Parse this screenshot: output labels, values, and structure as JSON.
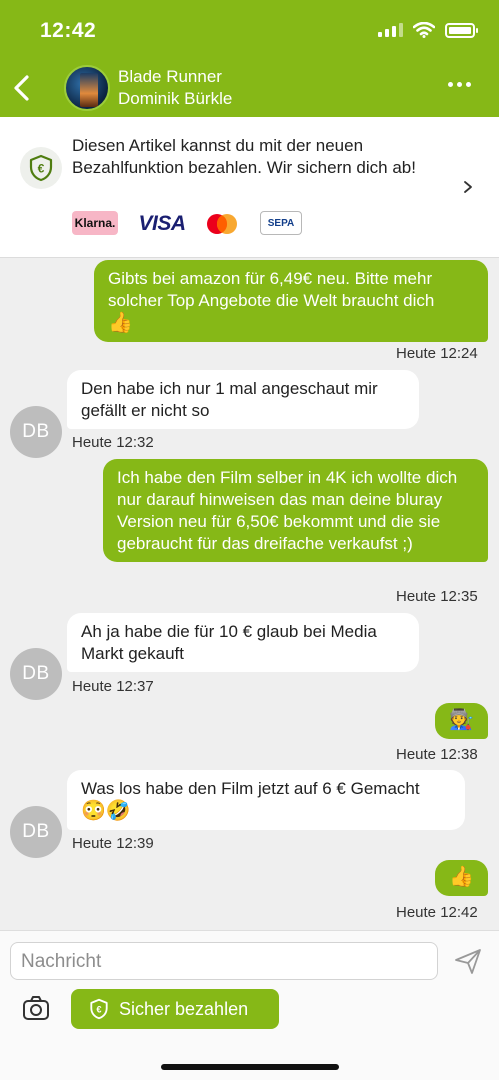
{
  "status_bar": {
    "time": "12:42"
  },
  "header": {
    "title": "Blade Runner",
    "subtitle": "Dominik Bürkle"
  },
  "banner": {
    "text": "Diesen Artikel kannst du mit der neuen Bezahlfunktion bezahlen. Wir sichern dich ab!",
    "payment_methods": {
      "klarna": "Klarna.",
      "visa": "VISA",
      "mastercard": "",
      "sepa": "SEPA"
    }
  },
  "messages": [
    {
      "side": "out",
      "text": "Gibts bei amazon für 6,49€ neu. Bitte mehr solcher Top Angebote die Welt braucht dich",
      "emoji": "👍",
      "time": "Heute 12:24"
    },
    {
      "side": "in",
      "avatar": "DB",
      "text": "Den habe ich nur 1 mal angeschaut mir gefällt er nicht so",
      "time": "Heute 12:32"
    },
    {
      "side": "out",
      "text": "Ich habe den Film selber in 4K ich wollte dich nur darauf hinweisen das man deine bluray Version neu für 6,50€ bekommt und die sie gebraucht für das dreifache verkaufst ;)",
      "time": "Heute 12:35"
    },
    {
      "side": "in",
      "avatar": "DB",
      "text": "Ah ja habe die für 10 € glaub bei Media Markt gekauft",
      "time": "Heute 12:37"
    },
    {
      "side": "out",
      "emoji": "🧑‍🏭",
      "time": "Heute 12:38"
    },
    {
      "side": "in",
      "avatar": "DB",
      "text": "Was los habe den Film jetzt auf 6 € Gemacht",
      "emoji": "😳🤣",
      "time": "Heute 12:39"
    },
    {
      "side": "out",
      "emoji": "👍",
      "time": "Heute 12:42"
    }
  ],
  "composer": {
    "placeholder": "Nachricht",
    "secure_pay_label": "Sicher bezahlen"
  },
  "colors": {
    "accent": "#86b817",
    "background": "#efefef",
    "avatar": "#bdbdbd"
  },
  "icons": [
    "back-icon",
    "more-icon",
    "shield-euro-icon",
    "chevron-right-icon",
    "send-icon",
    "camera-icon"
  ]
}
